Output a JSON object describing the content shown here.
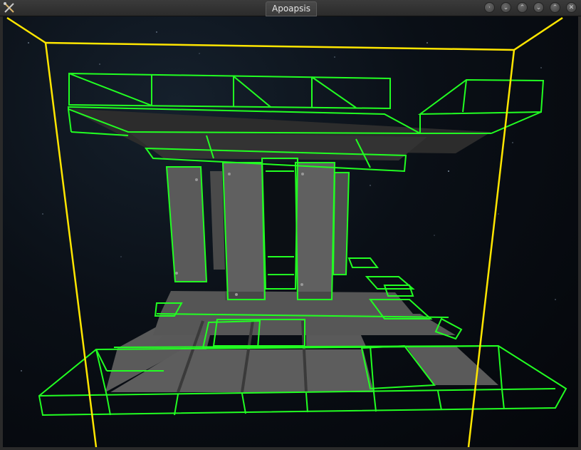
{
  "window": {
    "title": "Apoapsis",
    "app_icon": "crossed-tools-icon",
    "buttons": [
      {
        "name": "menu-button",
        "icon": "circle-dot-icon",
        "glyph": "·"
      },
      {
        "name": "shade-down-button",
        "icon": "double-chevron-down-icon",
        "glyph": "⌄"
      },
      {
        "name": "shade-up-button",
        "icon": "double-chevron-up-icon",
        "glyph": "⌃"
      },
      {
        "name": "minimize-button",
        "icon": "chevron-down-icon",
        "glyph": "⌄"
      },
      {
        "name": "maximize-button",
        "icon": "chevron-up-icon",
        "glyph": "⌃"
      },
      {
        "name": "close-button",
        "icon": "close-icon",
        "glyph": "✕"
      }
    ]
  },
  "scene": {
    "background": "space-starfield",
    "selection_color": "#22ff22",
    "bounds_color": "#ffee00",
    "hull_color": "#555555"
  }
}
